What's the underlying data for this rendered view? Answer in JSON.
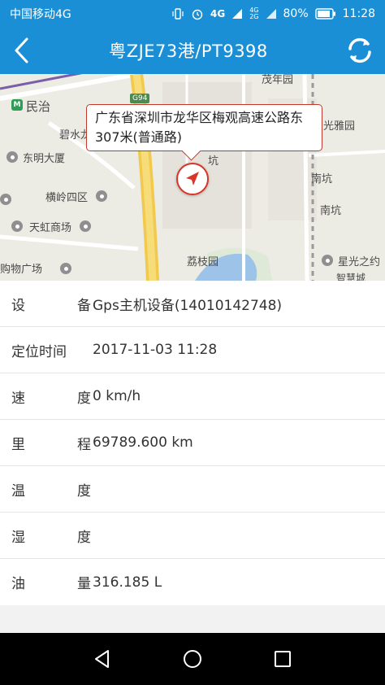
{
  "status_bar": {
    "carrier": "中国移动4G",
    "net_type_1": "4G",
    "net_type_2a": "4G",
    "net_type_2b": "2G",
    "battery": "80%",
    "time": "11:28"
  },
  "header": {
    "title": "粤ZJE73港/PT9398"
  },
  "map": {
    "callout_text": "广东省深圳市龙华区梅观高速公路东307米(普通路)",
    "road_shield": "G94",
    "labels": {
      "minzhi": "民治",
      "bishui": "碧水龙",
      "dongming": "东明大厦",
      "hengling": "横岭四区",
      "tianhong": "天虹商场",
      "gouwu": "购物广场",
      "guangya": "光雅园",
      "nankeng_1": "南坑",
      "nankeng_2": "南坑",
      "lizhi": "荔枝园",
      "xingguang": "星光之约",
      "zhihui": "智慧城",
      "top_right": "茂年园",
      "mid_keng": "坑"
    }
  },
  "info": {
    "rows": [
      {
        "label": [
          "设",
          "备"
        ],
        "value": "Gps主机设备(14010142748)"
      },
      {
        "label": [
          "定位时间"
        ],
        "value": "2017-11-03 11:28"
      },
      {
        "label": [
          "速",
          "度"
        ],
        "value": "0 km/h"
      },
      {
        "label": [
          "里",
          "程"
        ],
        "value": "69789.600 km"
      },
      {
        "label": [
          "温",
          "度"
        ],
        "value": ""
      },
      {
        "label": [
          "湿",
          "度"
        ],
        "value": ""
      },
      {
        "label": [
          "油",
          "量"
        ],
        "value": "316.185 L"
      }
    ]
  },
  "colors": {
    "primary": "#1a8fd6",
    "marker": "#d9352a",
    "callout_border": "#c0392b"
  }
}
